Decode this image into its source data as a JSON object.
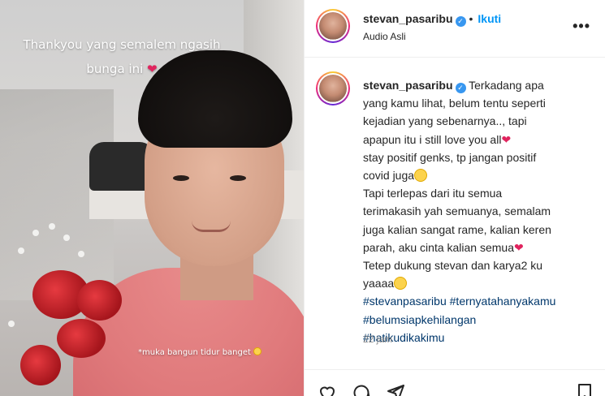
{
  "media": {
    "caption_top_line1": "Thankyou yang semalem ngasih",
    "caption_top_line2": "bunga ini",
    "caption_bottom": "*muka bangun tidur banget"
  },
  "header": {
    "username": "stevan_pasaribu",
    "separator": "•",
    "follow_label": "Ikuti",
    "audio_label": "Audio Asli",
    "more_label": "•••"
  },
  "post": {
    "username": "stevan_pasaribu",
    "line1": "Terkadang apa",
    "line2": "yang kamu lihat, belum tentu seperti",
    "line3": "kejadian yang sebenarnya.., tapi",
    "line4": "apapun itu i still love you all",
    "line5": "stay positif genks, tp jangan positif",
    "line6": "covid juga",
    "line7": "Tapi terlepas dari itu semua",
    "line8": "terimakasih yah semuanya, semalam",
    "line9": "juga kalian sangat rame, kalian keren",
    "line10": "parah, aku cinta kalian semua",
    "line11": "Tetep dukung stevan dan karya2 ku",
    "line12": "yaaaa",
    "hashtags": [
      "#stevanpasaribu",
      "#ternyatahanyakamu",
      "#belumsiapkehilangan",
      "#hatikudikakimu"
    ],
    "time": "22 jam"
  },
  "colors": {
    "accent": "#0095f6",
    "hashtag": "#00376b",
    "heart": "#e0245e",
    "muted": "#8e8e8e"
  }
}
